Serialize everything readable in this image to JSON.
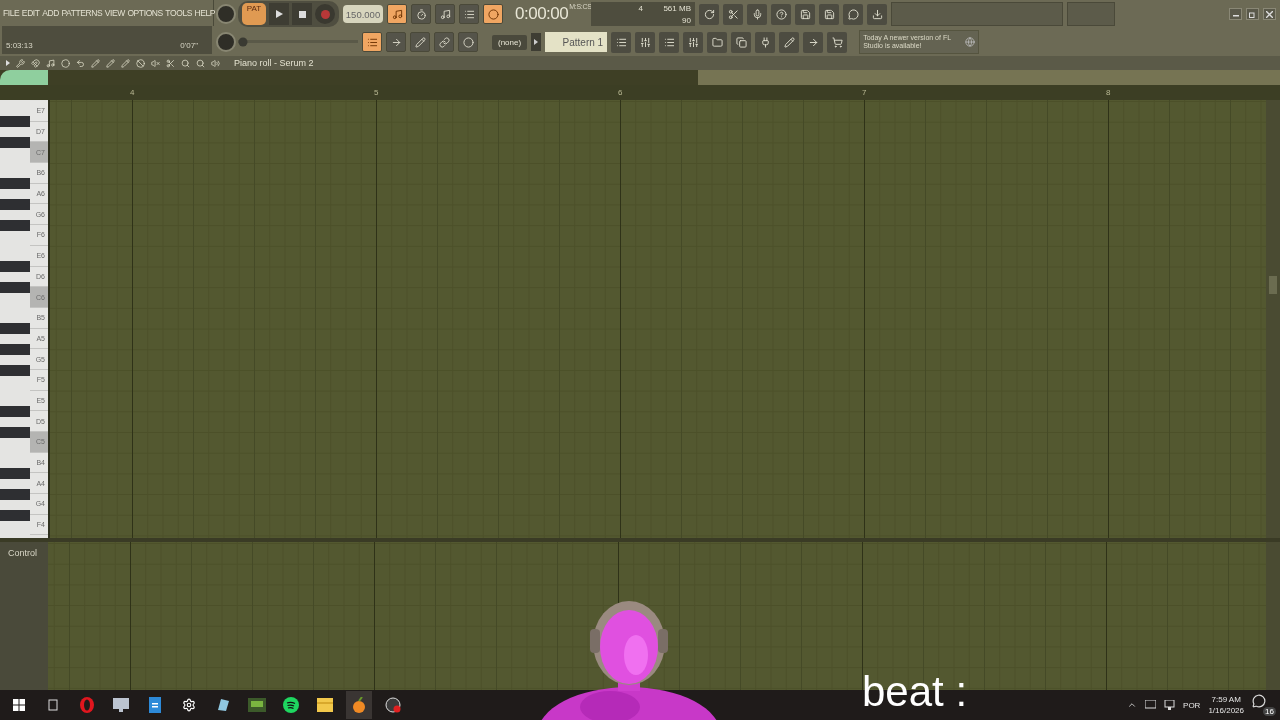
{
  "menu": [
    "FILE",
    "EDIT",
    "ADD",
    "PATTERNS",
    "VIEW",
    "OPTIONS",
    "TOOLS",
    "HELP"
  ],
  "hint": {
    "time": "5:03:13",
    "duration": "0'07\""
  },
  "transport": {
    "pat": "PAT",
    "tempo": "150.000",
    "recording": false
  },
  "pitch": {
    "level": 0
  },
  "toggles_top": [
    {
      "on": true
    },
    {
      "on": false
    },
    {
      "on": false
    },
    {
      "on": false
    },
    {
      "on": true
    }
  ],
  "toggles_bottom": [
    {
      "on": true
    },
    {
      "on": false
    },
    {
      "on": false
    },
    {
      "on": false
    },
    {
      "on": false
    }
  ],
  "clock": {
    "time": "0:00:00",
    "unit": "M:S:CS"
  },
  "monitor": {
    "polyphony": "4",
    "memory": "561 MB",
    "cpu": "90"
  },
  "pattern": {
    "channel": "(none)",
    "name": "Pattern 1"
  },
  "news": {
    "tag": "Today",
    "text": "A newer version of FL Studio is available!"
  },
  "piano_roll": {
    "title": "Piano roll - Serum 2",
    "bars": [
      "4",
      "5",
      "6",
      "7",
      "8"
    ],
    "keys": [
      {
        "label": "E7",
        "shaded": false,
        "black_below": true
      },
      {
        "label": "D7",
        "shaded": false,
        "black_below": true
      },
      {
        "label": "C7",
        "shaded": true,
        "black_below": false
      },
      {
        "label": "B6",
        "shaded": false,
        "black_below": true
      },
      {
        "label": "A6",
        "shaded": false,
        "black_below": true
      },
      {
        "label": "G6",
        "shaded": false,
        "black_below": true
      },
      {
        "label": "F6",
        "shaded": false,
        "black_below": false
      },
      {
        "label": "E6",
        "shaded": false,
        "black_below": true
      },
      {
        "label": "D6",
        "shaded": false,
        "black_below": true
      },
      {
        "label": "C6",
        "shaded": true,
        "black_below": false
      },
      {
        "label": "B5",
        "shaded": false,
        "black_below": true
      },
      {
        "label": "A5",
        "shaded": false,
        "black_below": true
      },
      {
        "label": "G5",
        "shaded": false,
        "black_below": true
      },
      {
        "label": "F5",
        "shaded": false,
        "black_below": false
      },
      {
        "label": "E5",
        "shaded": false,
        "black_below": true
      },
      {
        "label": "D5",
        "shaded": false,
        "black_below": true
      },
      {
        "label": "C5",
        "shaded": true,
        "black_below": false
      },
      {
        "label": "B4",
        "shaded": false,
        "black_below": true
      },
      {
        "label": "A4",
        "shaded": false,
        "black_below": true
      },
      {
        "label": "G4",
        "shaded": false,
        "black_below": true
      },
      {
        "label": "F4",
        "shaded": false,
        "black_below": false
      }
    ],
    "control_label": "Control"
  },
  "caption": "beat :",
  "tray": {
    "language": "POR",
    "time": "7:59 AM",
    "date": "1/16/2026",
    "notifications": "16"
  }
}
